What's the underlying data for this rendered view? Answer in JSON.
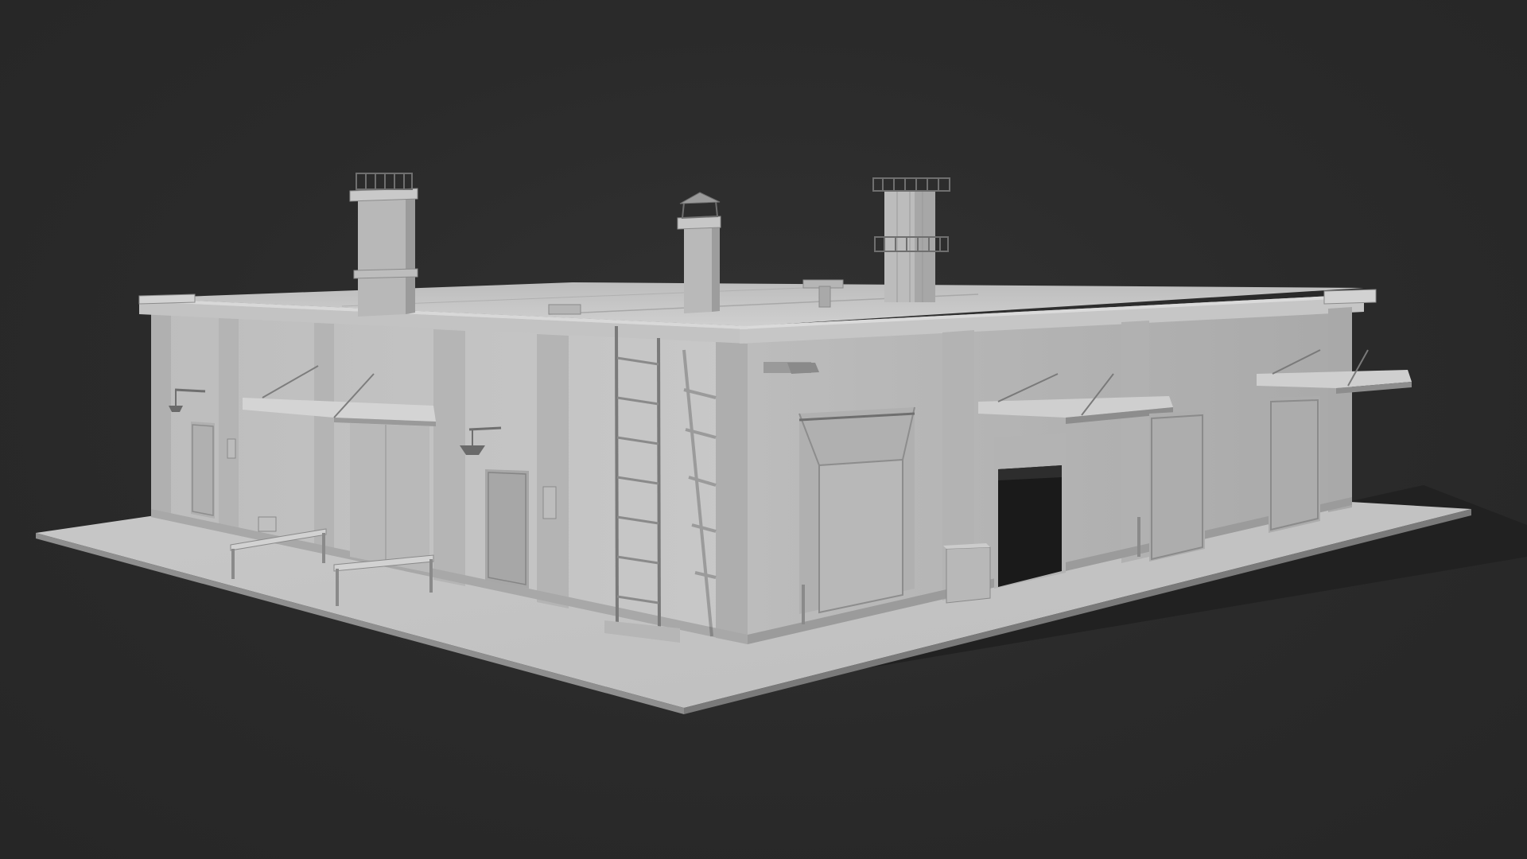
{
  "scene": {
    "subject": "industrial-building-clay-render",
    "background_color": "#2b2b2b",
    "model_color": "#c9c9c9",
    "shadow_color": "#1e1e1e",
    "roof_items": {
      "chimneys": 3,
      "roof_vents": 3
    },
    "front_facade": {
      "roll_up_doors": 3,
      "open_bay": 1,
      "awnings": 2
    },
    "left_facade": {
      "doors": 2,
      "awnings": 1,
      "wall_lamps": 2,
      "bollard_rails": 2,
      "ladder": 1
    }
  }
}
